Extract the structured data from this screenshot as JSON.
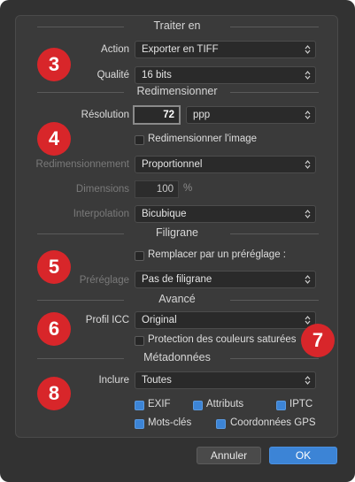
{
  "colors": {
    "accent": "#3c84d6",
    "badge": "#d8262a",
    "background": "#323232"
  },
  "sections": {
    "traiter": {
      "title": "Traiter en",
      "badge": "3"
    },
    "redim": {
      "title": "Redimensionner",
      "badge": "4"
    },
    "filigrane": {
      "title": "Filigrane",
      "badge": "5"
    },
    "avance": {
      "title": "Avancé",
      "badge": "6"
    },
    "avance_extra_badge": "7",
    "meta": {
      "title": "Métadonnées",
      "badge": "8"
    }
  },
  "traiter": {
    "action_label": "Action",
    "action_value": "Exporter en TIFF",
    "qualite_label": "Qualité",
    "qualite_value": "16 bits"
  },
  "redim": {
    "resolution_label": "Résolution",
    "resolution_value": "72",
    "resolution_unit": "ppp",
    "resize_checkbox_label": "Redimensionner l'image",
    "resize_checked": false,
    "mode_label": "Redimensionnement",
    "mode_value": "Proportionnel",
    "dimensions_label": "Dimensions",
    "dimensions_value": "100",
    "dimensions_unit": "%",
    "interp_label": "Interpolation",
    "interp_value": "Bicubique"
  },
  "filigrane": {
    "replace_label": "Remplacer par un préréglage :",
    "replace_checked": false,
    "preset_label": "Préréglage",
    "preset_value": "Pas de filigrane"
  },
  "avance": {
    "icc_label": "Profil ICC",
    "icc_value": "Original",
    "protect_label": "Protection des couleurs saturées",
    "protect_checked": false
  },
  "meta": {
    "include_label": "Inclure",
    "include_value": "Toutes",
    "options": {
      "exif": "EXIF",
      "attributs": "Attributs",
      "iptc": "IPTC",
      "motscles": "Mots-clés",
      "gps": "Coordonnées GPS"
    }
  },
  "buttons": {
    "cancel": "Annuler",
    "ok": "OK"
  }
}
